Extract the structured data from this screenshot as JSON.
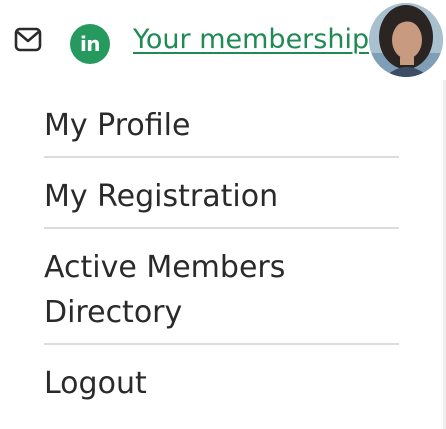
{
  "header": {
    "mail_icon": "mail-icon",
    "linkedin_icon": "linkedin-icon",
    "linkedin_glyph": "in",
    "membership_link": "Your membership",
    "avatar_icon": "user-avatar",
    "accent_color": "#1f8a53"
  },
  "menu": {
    "items": [
      {
        "label": "My Profile"
      },
      {
        "label": "My Registration"
      },
      {
        "label": "Active Members Directory"
      },
      {
        "label": "Logout"
      }
    ]
  }
}
